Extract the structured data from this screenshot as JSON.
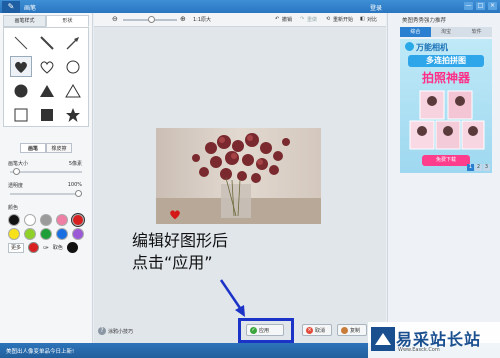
{
  "window": {
    "title": "画笔",
    "login_label": "登录",
    "controls": [
      "—",
      "□",
      "×"
    ]
  },
  "left_panel": {
    "tabs": [
      {
        "label": "画笔样式",
        "active": false
      },
      {
        "label": "形状",
        "active": true
      }
    ],
    "shapes": [
      {
        "name": "line-thin",
        "selected": false
      },
      {
        "name": "line-medium",
        "selected": false
      },
      {
        "name": "arrow",
        "selected": false
      },
      {
        "name": "heart-filled",
        "selected": true
      },
      {
        "name": "heart-outline",
        "selected": false
      },
      {
        "name": "circle-outline",
        "selected": false
      },
      {
        "name": "circle-filled",
        "selected": false
      },
      {
        "name": "triangle-filled",
        "selected": false
      },
      {
        "name": "triangle-outline",
        "selected": false
      },
      {
        "name": "square-outline",
        "selected": false
      },
      {
        "name": "square-filled",
        "selected": false
      },
      {
        "name": "star-filled",
        "selected": false
      }
    ],
    "subtabs": [
      {
        "label": "画笔",
        "active": true
      },
      {
        "label": "橡皮擦",
        "active": false
      }
    ],
    "brush_size_label": "画笔大小",
    "brush_size_value": "5像素",
    "brush_size_fraction": 0.05,
    "opacity_label": "透明度",
    "opacity_value": "100%",
    "opacity_fraction": 1.0,
    "color_label": "颜色",
    "colors": [
      "#111111",
      "#ffffff",
      "#9b9b9b",
      "#f07fa6",
      "#d92020",
      "#f7e11a",
      "#8fd12a",
      "#1f9e3a",
      "#1a6fe0",
      "#9b59d6"
    ],
    "selected_color": "#d92020",
    "more_label": "更多",
    "picker_label": "取色"
  },
  "toolbar": {
    "zoom_minus": "⊖",
    "zoom_plus": "⊕",
    "zoom_ratio": "1:1原大",
    "undo_label": "撤销",
    "redo_label": "重做",
    "restart_label": "重新开始",
    "compare_label": "对比"
  },
  "canvas": {
    "annotation_line1": "编辑好图形后",
    "annotation_line2": "点击“应用”"
  },
  "bottom_bar": {
    "tips_label": "涂鸦小技巧",
    "apply_label": "应用",
    "cancel_label": "取消",
    "copy_label": "复制"
  },
  "right_panel": {
    "title": "美图秀秀强力推荐",
    "tabs": [
      {
        "label": "综合",
        "active": true
      },
      {
        "label": "淘宝",
        "active": false
      },
      {
        "label": "软件",
        "active": false
      }
    ],
    "ad_brand": "万能相机",
    "ad_line1": "多连拍拼图",
    "ad_line2": "拍照神器",
    "ad_button": "免费下载",
    "pager": [
      "1",
      "2",
      "3"
    ]
  },
  "status_bar": {
    "news": "美图出人像变单品今日上新!"
  },
  "watermark": {
    "logo_text": "易采站长站",
    "url_text": "Www.Easck.Com"
  },
  "colors": {
    "title_bar": "#2a76c0",
    "accent": "#2b7fd0",
    "highlight_box": "#1c33c8",
    "apply_green": "#3aa53a"
  }
}
